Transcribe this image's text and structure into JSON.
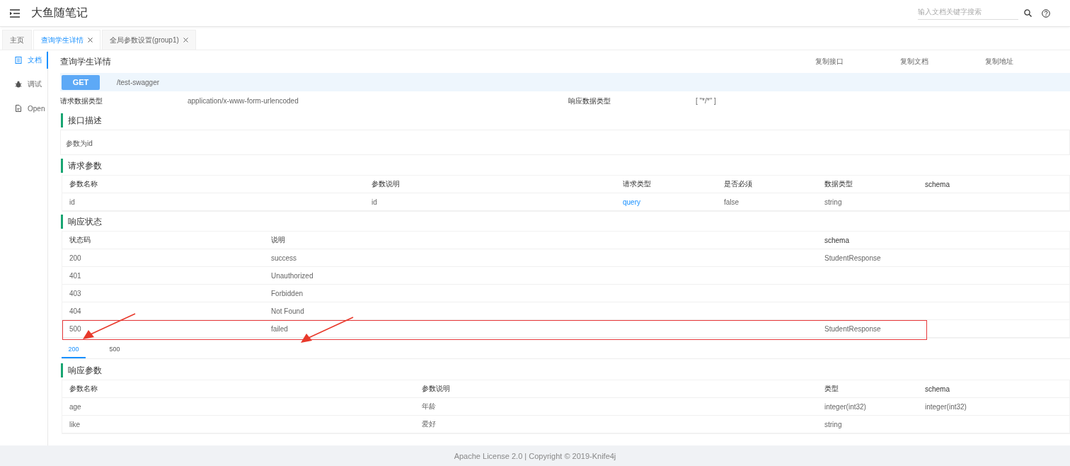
{
  "header": {
    "title": "大鱼随笔记",
    "search": {
      "placeholder": "输入文档关键字搜索"
    }
  },
  "tabs": [
    {
      "label": "主页",
      "closable": false,
      "selected": false
    },
    {
      "label": "查询学生详情",
      "closable": true,
      "selected": true
    },
    {
      "label": "全局参数设置(group1)",
      "closable": true,
      "selected": false
    }
  ],
  "sidebar": {
    "items": [
      {
        "label": "文档",
        "selected": true
      },
      {
        "label": "调试",
        "selected": false
      },
      {
        "label": "Open",
        "selected": false
      }
    ]
  },
  "doc": {
    "title": "查询学生详情",
    "actions": [
      "复制接口",
      "复制文档",
      "复制地址"
    ],
    "method": "GET",
    "path": "/test-swagger",
    "request_type_label": "请求数据类型",
    "request_type": "application/x-www-form-urlencoded",
    "response_type_label": "响应数据类型",
    "response_type": "[ \"*/*\" ]",
    "sections": [
      {
        "kind": "text",
        "title": "接口描述",
        "text": "参数为id"
      },
      {
        "kind": "table",
        "title": "请求参数",
        "columns": [
          {
            "label": "参数名称"
          },
          {
            "label": "参数说明"
          },
          {
            "label": "请求类型"
          },
          {
            "label": "是否必须"
          },
          {
            "label": "数据类型"
          },
          {
            "label": "schema"
          }
        ],
        "rows": [
          {
            "highlighted": false,
            "cells": [
              {
                "text": "id",
                "kind": "plain"
              },
              {
                "text": "id",
                "kind": "plain"
              },
              {
                "text": "query",
                "kind": "link"
              },
              {
                "text": "false",
                "kind": "plain"
              },
              {
                "text": "string",
                "kind": "plain"
              }
            ]
          }
        ]
      },
      {
        "kind": "table",
        "title": "响应状态",
        "columns": [
          {
            "label": "状态码"
          },
          {
            "label": "说明"
          },
          {
            "label": "schema"
          }
        ],
        "rows": [
          {
            "highlighted": false,
            "cells": [
              {
                "text": "200",
                "kind": "plain"
              },
              {
                "text": "success",
                "kind": "plain"
              },
              {
                "text": "StudentResponse",
                "kind": "plain"
              }
            ]
          },
          {
            "highlighted": false,
            "cells": [
              {
                "text": "401",
                "kind": "plain"
              },
              {
                "text": "Unauthorized",
                "kind": "plain"
              }
            ]
          },
          {
            "highlighted": false,
            "cells": [
              {
                "text": "403",
                "kind": "plain"
              },
              {
                "text": "Forbidden",
                "kind": "plain"
              }
            ]
          },
          {
            "highlighted": false,
            "cells": [
              {
                "text": "404",
                "kind": "plain"
              },
              {
                "text": "Not Found",
                "kind": "plain"
              }
            ]
          },
          {
            "highlighted": true,
            "cells": [
              {
                "text": "500",
                "kind": "plain"
              },
              {
                "text": "failed",
                "kind": "plain"
              },
              {
                "text": "StudentResponse",
                "kind": "plain"
              }
            ]
          }
        ],
        "status_tabs": [
          {
            "label": "200",
            "selected": true
          },
          {
            "label": "500",
            "selected": false
          }
        ]
      },
      {
        "kind": "table",
        "title": "响应参数",
        "columns": [
          {
            "label": "参数名称"
          },
          {
            "label": "参数说明"
          },
          {
            "label": "类型"
          },
          {
            "label": "schema"
          }
        ],
        "rows": [
          {
            "highlighted": false,
            "cells": [
              {
                "text": "age",
                "kind": "plain"
              },
              {
                "text": "年龄",
                "kind": "plain"
              },
              {
                "text": "integer(int32)",
                "kind": "plain"
              },
              {
                "text": "integer(int32)",
                "kind": "plain"
              }
            ]
          },
          {
            "highlighted": false,
            "cells": [
              {
                "text": "like",
                "kind": "plain"
              },
              {
                "text": "爱好",
                "kind": "plain"
              },
              {
                "text": "string",
                "kind": "plain"
              }
            ]
          }
        ]
      }
    ]
  },
  "footer": {
    "text": "Apache License 2.0 | Copyright © 2019-Knife4j"
  }
}
